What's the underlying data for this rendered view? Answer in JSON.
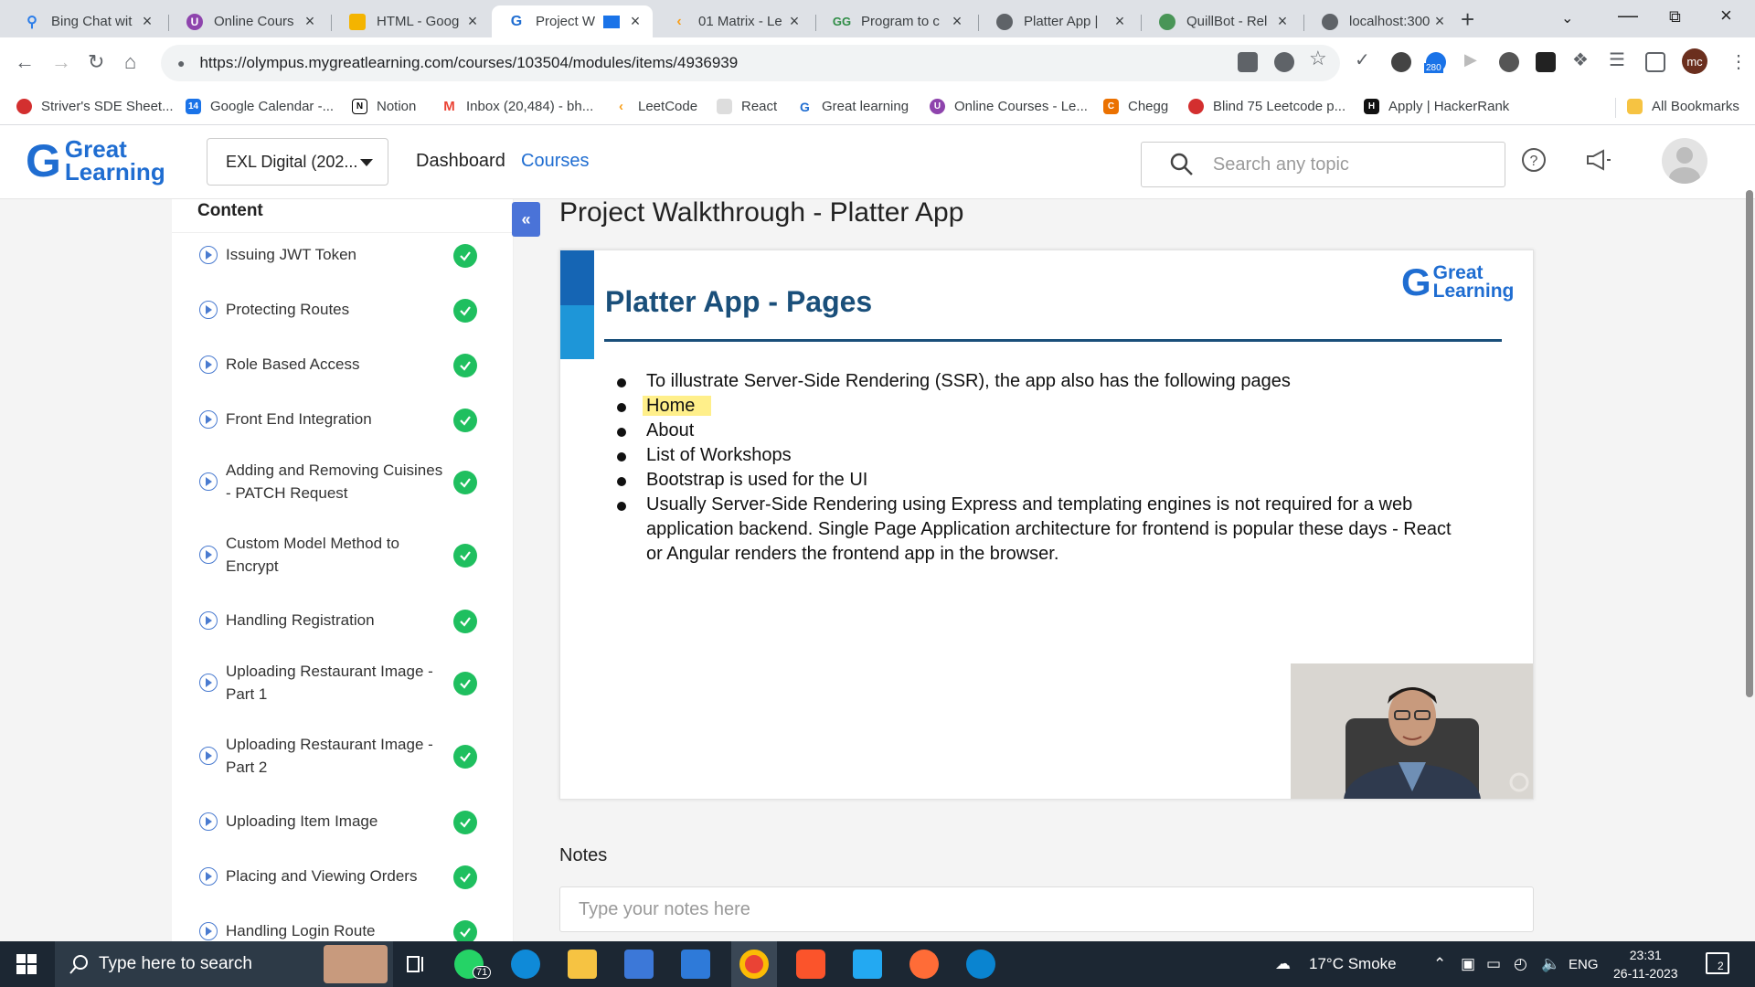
{
  "browser": {
    "tabs": [
      {
        "title": "Bing Chat wit",
        "icon": "search-icon",
        "color": "#2b7de9"
      },
      {
        "title": "Online Cours",
        "icon": "u-icon",
        "color": "#8e44ad"
      },
      {
        "title": "HTML - Goog",
        "icon": "slides-icon",
        "color": "#f4b400"
      },
      {
        "title": "Project W",
        "icon": "g-icon",
        "color": "#1f6dd1"
      },
      {
        "title": "01 Matrix - Le",
        "icon": "leetcode-icon",
        "color": "#333333"
      },
      {
        "title": "Program to c",
        "icon": "gfg-icon",
        "color": "#2f8d46"
      },
      {
        "title": "Platter App |",
        "icon": "globe-icon",
        "color": "#5f6368"
      },
      {
        "title": "QuillBot - Rel",
        "icon": "quillbot-icon",
        "color": "#499557"
      },
      {
        "title": "localhost:300",
        "icon": "globe-icon",
        "color": "#5f6368"
      }
    ],
    "url": "https://olympus.mygreatlearning.com/courses/103504/modules/items/4936939",
    "ext_badge": "280",
    "profile_initials": "mc",
    "bookmarks": [
      {
        "label": "Striver's SDE Sheet...",
        "color": "#d32f2f"
      },
      {
        "label": "Google Calendar -...",
        "color": "#1a73e8"
      },
      {
        "label": "Notion",
        "color": "#000000"
      },
      {
        "label": "Inbox (20,484) - bh...",
        "color": "#ea4335"
      },
      {
        "label": "LeetCode",
        "color": "#333333"
      },
      {
        "label": "React",
        "color": "#888888"
      },
      {
        "label": "Great learning",
        "color": "#1f6dd1"
      },
      {
        "label": "Online Courses - Le...",
        "color": "#8e44ad"
      },
      {
        "label": "Chegg",
        "color": "#eb7100"
      },
      {
        "label": "Blind 75 Leetcode p...",
        "color": "#d32f2f"
      },
      {
        "label": "Apply | HackerRank",
        "color": "#111111"
      }
    ],
    "all_bookmarks": "All Bookmarks"
  },
  "header": {
    "logo_line1": "Great",
    "logo_line2": "Learning",
    "course_select": "EXL Digital (202...",
    "nav_dashboard": "Dashboard",
    "nav_courses": "Courses",
    "search_placeholder": "Search any topic",
    "accent_color": "#1f6dd1"
  },
  "sidebar": {
    "title": "Content",
    "items": [
      {
        "label": "Issuing JWT Token",
        "completed": true
      },
      {
        "label": "Protecting Routes",
        "completed": true
      },
      {
        "label": "Role Based Access",
        "completed": true
      },
      {
        "label": "Front End Integration",
        "completed": true
      },
      {
        "label": "Adding and Removing Cuisines - PATCH Request",
        "completed": true
      },
      {
        "label": "Custom Model Method to Encrypt",
        "completed": true
      },
      {
        "label": "Handling Registration",
        "completed": true
      },
      {
        "label": "Uploading Restaurant Image - Part 1",
        "completed": true
      },
      {
        "label": "Uploading Restaurant Image - Part 2",
        "completed": true
      },
      {
        "label": "Uploading Item Image",
        "completed": true
      },
      {
        "label": "Placing and Viewing Orders",
        "completed": true
      },
      {
        "label": "Handling Login Route",
        "completed": true
      }
    ]
  },
  "main": {
    "title": "Project Walkthrough - Platter App",
    "slide": {
      "title": "Platter App - Pages",
      "logo_line1": "Great",
      "logo_line2": "Learning",
      "bullets": [
        "To illustrate Server-Side Rendering (SSR), the app also has the following pages",
        "Home",
        "About",
        "List of Workshops",
        "Bootstrap is used for the UI",
        "Usually Server-Side Rendering using Express and templating engines is not required for a web application backend. Single Page Application architecture for frontend is popular these days - React or Angular renders the frontend app in the browser."
      ],
      "highlight_color": "#ffef8a"
    },
    "notes_label": "Notes",
    "notes_placeholder": "Type your notes here"
  },
  "taskbar": {
    "search_placeholder": "Type here to search",
    "whatsapp_badge": "71",
    "weather": "17°C  Smoke",
    "lang": "ENG",
    "time": "23:31",
    "date": "26-11-2023",
    "notif_count": "2"
  }
}
